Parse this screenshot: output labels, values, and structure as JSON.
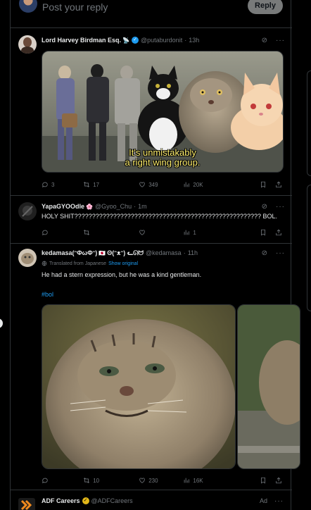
{
  "reply_box": {
    "placeholder": "Post your reply",
    "button": "Reply"
  },
  "tweets": [
    {
      "name": "Lord Harvey Birdman Esq.",
      "name_emoji": "📡",
      "handle": "@putaburdonit",
      "time": "13h",
      "caption_line1": "It's unmistakably",
      "caption_line2": "a right wing group.",
      "replies": "3",
      "reposts": "17",
      "likes": "349",
      "views": "20K"
    },
    {
      "name": "YapaGYOOdle",
      "name_emoji": "🌸",
      "handle": "@Gyoo_Chu",
      "time": "1m",
      "text": "HOLY SHIT????????????????????????????????????????????????????? BOL.",
      "replies": "",
      "reposts": "",
      "likes": "",
      "views": "1"
    },
    {
      "name": "kedamasa(ᵔΦωΦᵔ)",
      "name_emoji": "🇯🇵",
      "name_tail": "ʘ(ᵔᴥᵔ) ᓚᘏᗢ",
      "handle": "@kedamasa",
      "time": "11h",
      "translated_label": "Translated from Japanese",
      "show_original": "Show original",
      "text": "He had a stern expression, but he was a kind gentleman.",
      "hashtag": "#bol",
      "replies": "",
      "reposts": "10",
      "likes": "230",
      "views": "16K"
    },
    {
      "name": "ADF Careers",
      "handle": "@ADFCareers",
      "ad_label": "Ad"
    }
  ],
  "colors": {
    "accent": "#1d9bf0",
    "gold": "#e2b719",
    "muted": "#71767b",
    "border": "#2f3336"
  }
}
